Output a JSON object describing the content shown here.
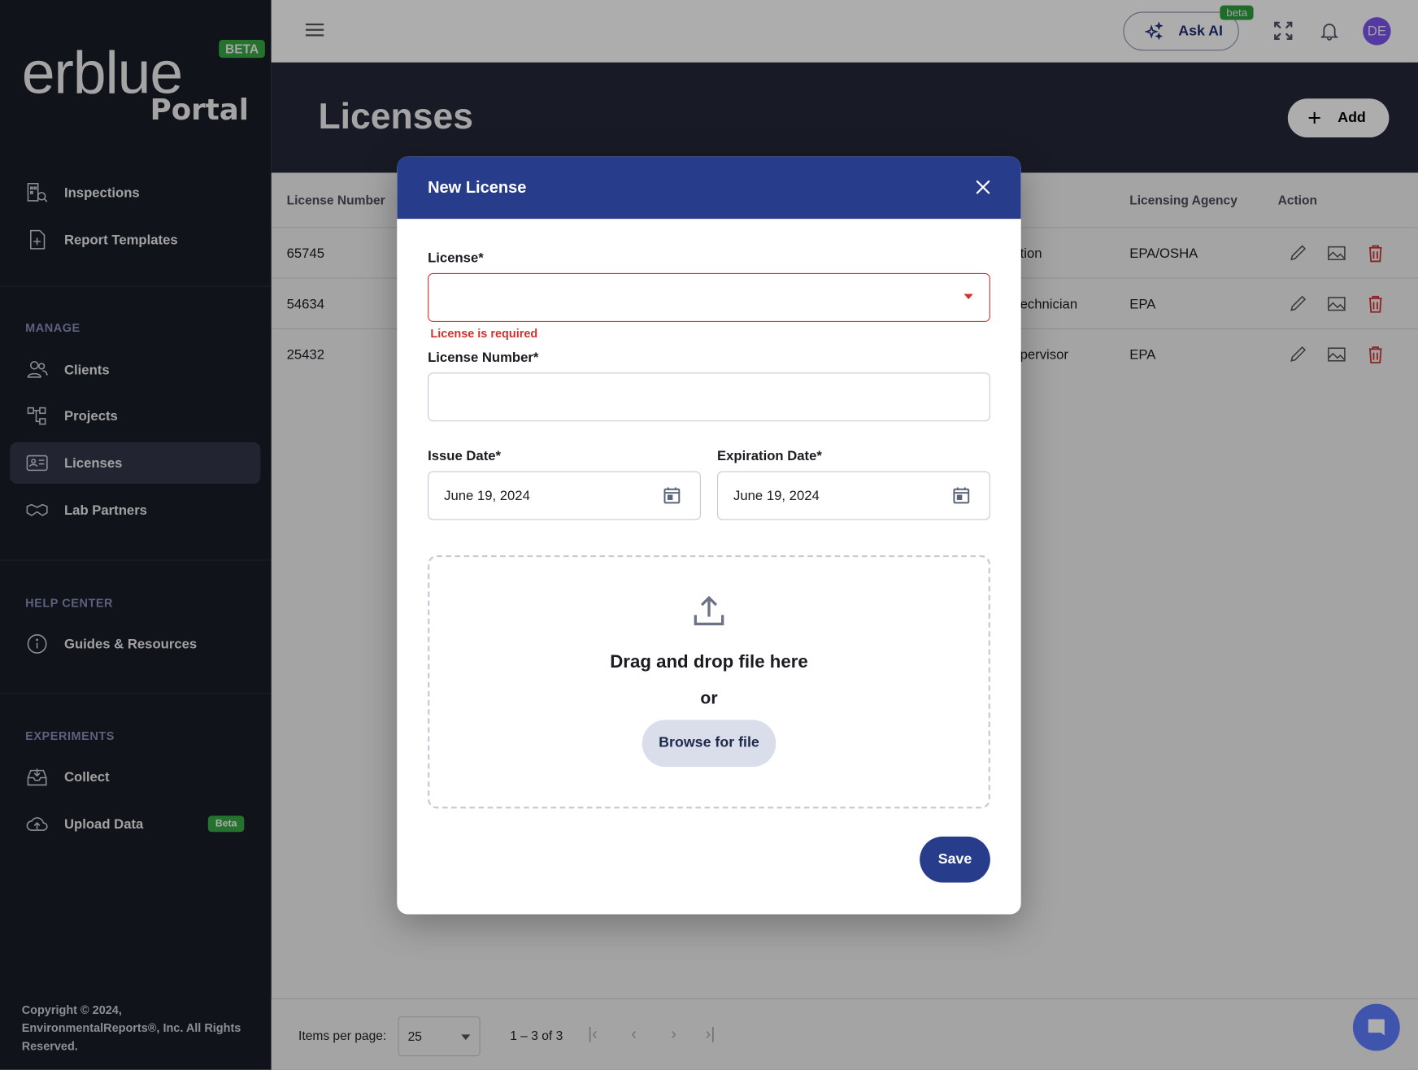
{
  "brand": {
    "name": "erblue",
    "sub": "Portal",
    "badge": "BETA"
  },
  "sidebar": {
    "items": [
      {
        "label": "Inspections",
        "icon": "building-search-icon"
      },
      {
        "label": "Report Templates",
        "icon": "document-plus-icon"
      }
    ],
    "manage_title": "MANAGE",
    "manage": [
      {
        "label": "Clients",
        "icon": "users-icon"
      },
      {
        "label": "Projects",
        "icon": "hierarchy-icon"
      },
      {
        "label": "Licenses",
        "icon": "id-card-icon",
        "active": true
      },
      {
        "label": "Lab Partners",
        "icon": "handshake-icon"
      }
    ],
    "help_title": "HELP CENTER",
    "help": [
      {
        "label": "Guides & Resources",
        "icon": "info-icon"
      }
    ],
    "experiments_title": "EXPERIMENTS",
    "experiments": [
      {
        "label": "Collect",
        "icon": "inbox-download-icon"
      },
      {
        "label": "Upload Data",
        "icon": "cloud-upload-icon",
        "badge": "Beta"
      }
    ],
    "copyright": "Copyright © 2024, EnvironmentalReports®, Inc. All Rights Reserved."
  },
  "topbar": {
    "ask_ai": "Ask AI",
    "ask_ai_badge": "beta",
    "avatar": "DE"
  },
  "page": {
    "title": "Licenses",
    "add_label": "Add"
  },
  "table": {
    "headers": {
      "license_number": "License Number",
      "licensing_agency": "Licensing Agency",
      "action": "Action"
    },
    "rows": [
      {
        "number": "65745",
        "partial": "tion",
        "agency": "EPA/OSHA"
      },
      {
        "number": "54634",
        "partial": "echnician",
        "agency": "EPA"
      },
      {
        "number": "25432",
        "partial": "pervisor",
        "agency": "EPA"
      }
    ]
  },
  "pagination": {
    "items_per_page_label": "Items per page:",
    "items_per_page": "25",
    "range": "1 – 3 of 3"
  },
  "dialog": {
    "title": "New License",
    "license_label": "License*",
    "license_value": "",
    "license_error": "License is required",
    "number_label": "License Number*",
    "number_value": "",
    "issue_label": "Issue Date*",
    "issue_value": "June 19, 2024",
    "expiration_label": "Expiration Date*",
    "expiration_value": "June 19, 2024",
    "drop_text": "Drag and drop file here",
    "or": "or",
    "browse": "Browse for file",
    "save": "Save"
  },
  "colors": {
    "primary": "#283c8c",
    "error": "#d3302f",
    "beta": "#37a845",
    "avatar": "#7c55f0"
  }
}
